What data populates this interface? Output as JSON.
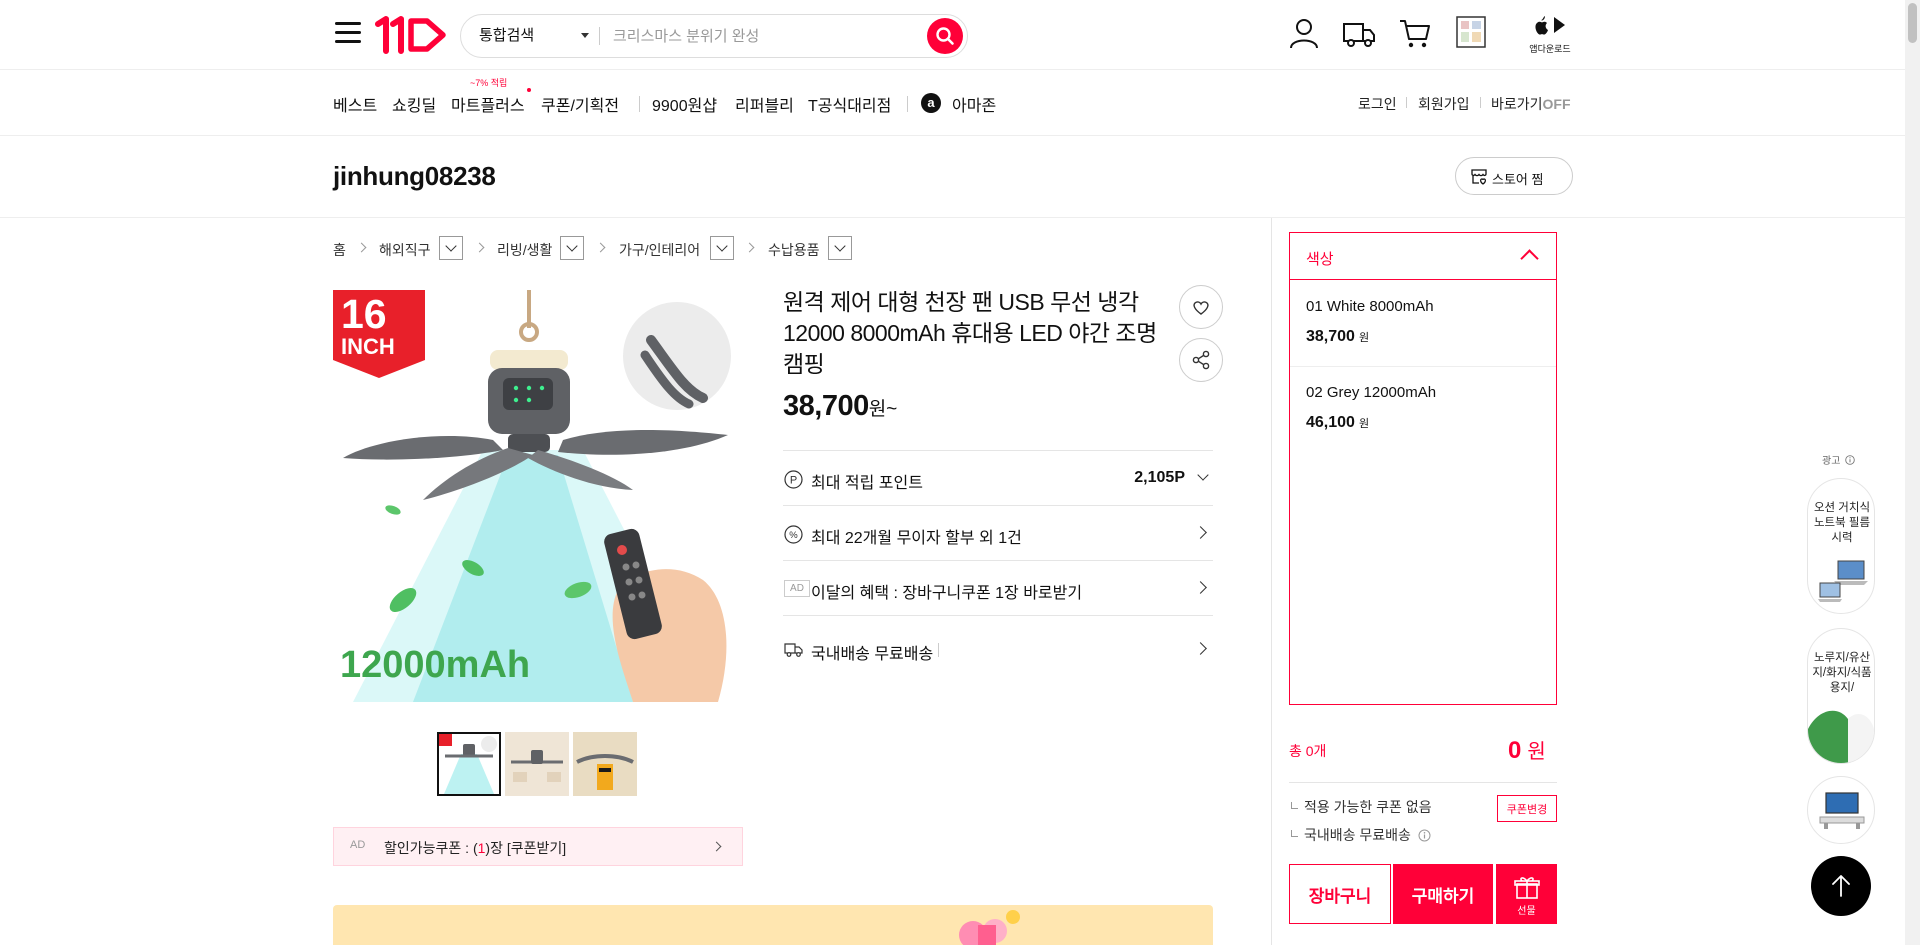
{
  "header": {
    "search_scope": "통합검색",
    "search_placeholder": "크리스마스 분위기 완성",
    "app_download_label": "앱다운로드"
  },
  "nav": {
    "items": [
      "베스트",
      "쇼킹딜",
      "마트플러스",
      "쿠폰/기획전",
      "9900원샵",
      "리퍼블리",
      "T공식대리점",
      "아마존"
    ],
    "mart_badge": "~7% 적립",
    "amazon_logo": "a",
    "util": [
      "로그인",
      "회원가입",
      "바로가기"
    ],
    "shortcut_state": "OFF"
  },
  "store": {
    "name": "jinhung08238",
    "fav_label": "스토어 찜"
  },
  "breadcrumb": [
    "홈",
    "해외직구",
    "리빙/생활",
    "가구/인테리어",
    "수납용품"
  ],
  "product": {
    "image_badge_top": "16",
    "image_badge_bottom": "INCH",
    "image_caption": "12000mAh",
    "title": "원격 제어 대형 천장 팬 USB 무선 냉각 12000 8000mAh 휴대용 LED 야간 조명 캠핑",
    "price": "38,700",
    "price_unit": "원~",
    "rows": {
      "points_label": "최대 적립 포인트",
      "points_value": "2,105P",
      "installment_label": "최대 22개월 무이자 할부 외 1건",
      "ad_tag": "AD",
      "benefit_label": "이달의 혜택 : 장바구니쿠폰 1장 바로받기",
      "shipping_label": "국내배송 무료배송"
    },
    "coupon_bar": {
      "ad": "AD",
      "prefix": "할인가능쿠폰 : (",
      "count": "1",
      "suffix": ")장 [쿠폰받기]"
    }
  },
  "options": {
    "header": "색상",
    "items": [
      {
        "name": "01 White 8000mAh",
        "price": "38,700",
        "unit": "원"
      },
      {
        "name": "02 Grey 12000mAh",
        "price": "46,100",
        "unit": "원"
      }
    ]
  },
  "order": {
    "total_label": "총 0개",
    "total_price": "0",
    "total_unit": "원",
    "coupon_note": "적용 가능한 쿠폰 없음",
    "shipping_note": "국내배송 무료배송",
    "coupon_change": "쿠폰변경",
    "cart": "장바구니",
    "buy": "구매하기",
    "gift": "선물"
  },
  "ads": {
    "label": "광고",
    "cards": [
      "오션 거치식 노트북 필름 시력",
      "노루지/유산지/화지/식품용지/"
    ]
  },
  "colors": {
    "brand_red": "#ff0038",
    "coupon_bg": "#fff0f3",
    "banner_bg": "#ffe6b0"
  }
}
